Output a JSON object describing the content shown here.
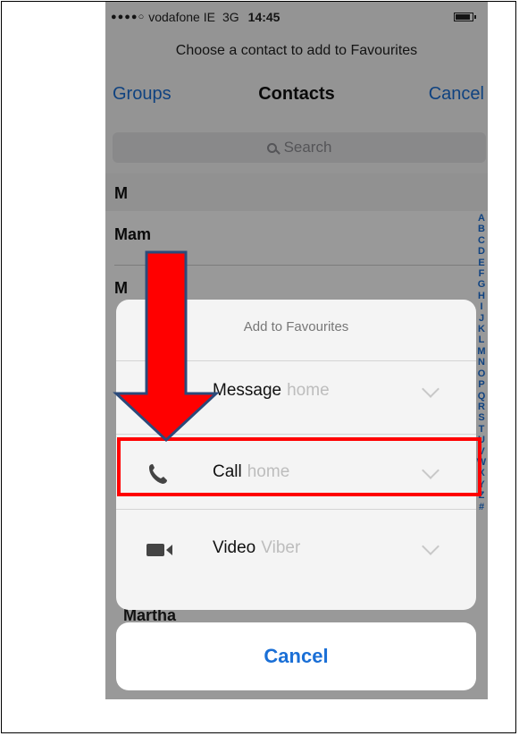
{
  "status": {
    "carrier": "vodafone IE",
    "network": "3G",
    "time": "14:45"
  },
  "prompt": "Choose a contact to add to Favourites",
  "nav": {
    "left": "Groups",
    "title": "Contacts",
    "right": "Cancel"
  },
  "search": {
    "placeholder": "Search"
  },
  "list": {
    "section": "M",
    "rows": [
      "Mam",
      "M",
      "Martha"
    ]
  },
  "index_letters": [
    "A",
    "B",
    "C",
    "D",
    "E",
    "F",
    "G",
    "H",
    "I",
    "J",
    "K",
    "L",
    "M",
    "N",
    "O",
    "P",
    "Q",
    "R",
    "S",
    "T",
    "U",
    "V",
    "W",
    "X",
    "Y",
    "Z",
    "#"
  ],
  "sheet": {
    "title": "Add to Favourites",
    "options": [
      {
        "label": "Message",
        "sub": "home",
        "icon": "message-icon"
      },
      {
        "label": "Call",
        "sub": "home",
        "icon": "phone-icon"
      },
      {
        "label": "Video",
        "sub": "Viber",
        "icon": "video-camera-icon"
      }
    ]
  },
  "cancel": "Cancel",
  "colors": {
    "accent": "#1a6fd6",
    "annotation": "#ff0000"
  }
}
